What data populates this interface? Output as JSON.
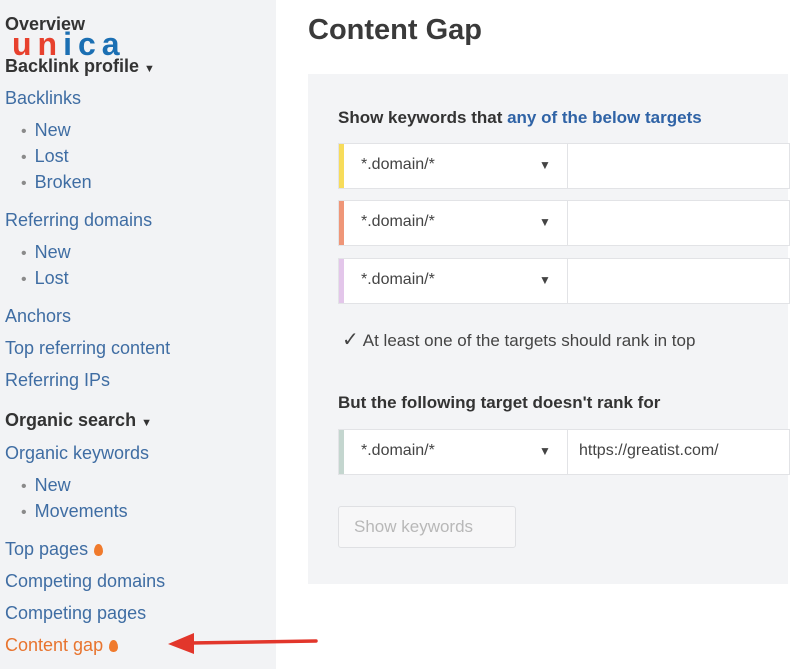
{
  "logo": {
    "part1": "un",
    "part2": "ica"
  },
  "sidebar": {
    "overview": "Overview",
    "backlink_profile": "Backlink profile",
    "backlinks": "Backlinks",
    "backlinks_new": "New",
    "backlinks_lost": "Lost",
    "backlinks_broken": "Broken",
    "referring_domains": "Referring domains",
    "refdomains_new": "New",
    "refdomains_lost": "Lost",
    "anchors": "Anchors",
    "top_referring_content": "Top referring content",
    "referring_ips": "Referring IPs",
    "organic_search": "Organic search",
    "organic_keywords": "Organic keywords",
    "orgkw_new": "New",
    "orgkw_movements": "Movements",
    "top_pages": "Top pages",
    "competing_domains": "Competing domains",
    "competing_pages": "Competing pages",
    "content_gap": "Content gap"
  },
  "main": {
    "title": "Content Gap",
    "show_prefix": "Show keywords that ",
    "show_highlight": "any of the below targets",
    "targets": [
      {
        "mode": "*.domain/*",
        "value": "",
        "color": "#f7dc5a"
      },
      {
        "mode": "*.domain/*",
        "value": "",
        "color": "#ef9678"
      },
      {
        "mode": "*.domain/*",
        "value": "",
        "color": "#e3c6ea"
      }
    ],
    "checkbox_label": "At least one of the targets should rank in top",
    "but_label": "But the following target doesn't rank for",
    "exclude": {
      "mode": "*.domain/*",
      "value": "https://greatist.com/",
      "color": "#c4d6cf"
    },
    "show_button": "Show keywords"
  },
  "colors": {
    "accent": "#2f63a6",
    "orange": "#e8742e",
    "arrow": "#e2362b"
  }
}
